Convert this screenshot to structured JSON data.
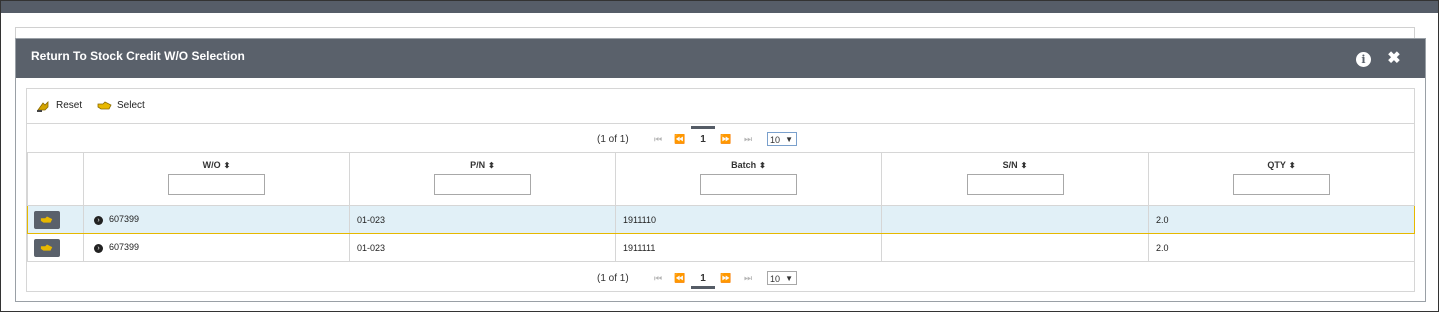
{
  "dialog": {
    "title": "Return To Stock Credit W/O Selection",
    "info_icon": "info-icon",
    "close_icon": "close-icon"
  },
  "toolbar": {
    "reset_label": "Reset",
    "select_label": "Select"
  },
  "pager": {
    "status": "(1 of 1)",
    "current_page": "1",
    "rows_per_page": "10"
  },
  "table": {
    "columns": [
      "W/O",
      "P/N",
      "Batch",
      "S/N",
      "QTY"
    ],
    "rows": [
      {
        "wo": "607399",
        "pn": "01-023",
        "batch": "1911110",
        "sn": "",
        "qty": "2.0",
        "selected": true
      },
      {
        "wo": "607399",
        "pn": "01-023",
        "batch": "1911111",
        "sn": "",
        "qty": "2.0",
        "selected": false
      }
    ]
  },
  "colors": {
    "header_bg": "#5a616b",
    "selected_row_bg": "#e1f0f7",
    "selected_row_border": "#e6b800"
  }
}
